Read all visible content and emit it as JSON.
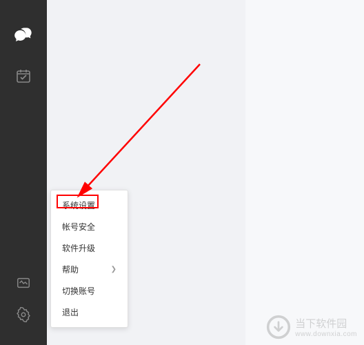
{
  "menu": {
    "items": [
      {
        "label": "系统设置",
        "hasSubmenu": false
      },
      {
        "label": "帐号安全",
        "hasSubmenu": false
      },
      {
        "label": "软件升级",
        "hasSubmenu": false
      },
      {
        "label": "帮助",
        "hasSubmenu": true
      },
      {
        "label": "切换账号",
        "hasSubmenu": false
      },
      {
        "label": "退出",
        "hasSubmenu": false
      }
    ]
  },
  "watermark": {
    "cn": "当下软件园",
    "en": "www.downxia.com"
  }
}
